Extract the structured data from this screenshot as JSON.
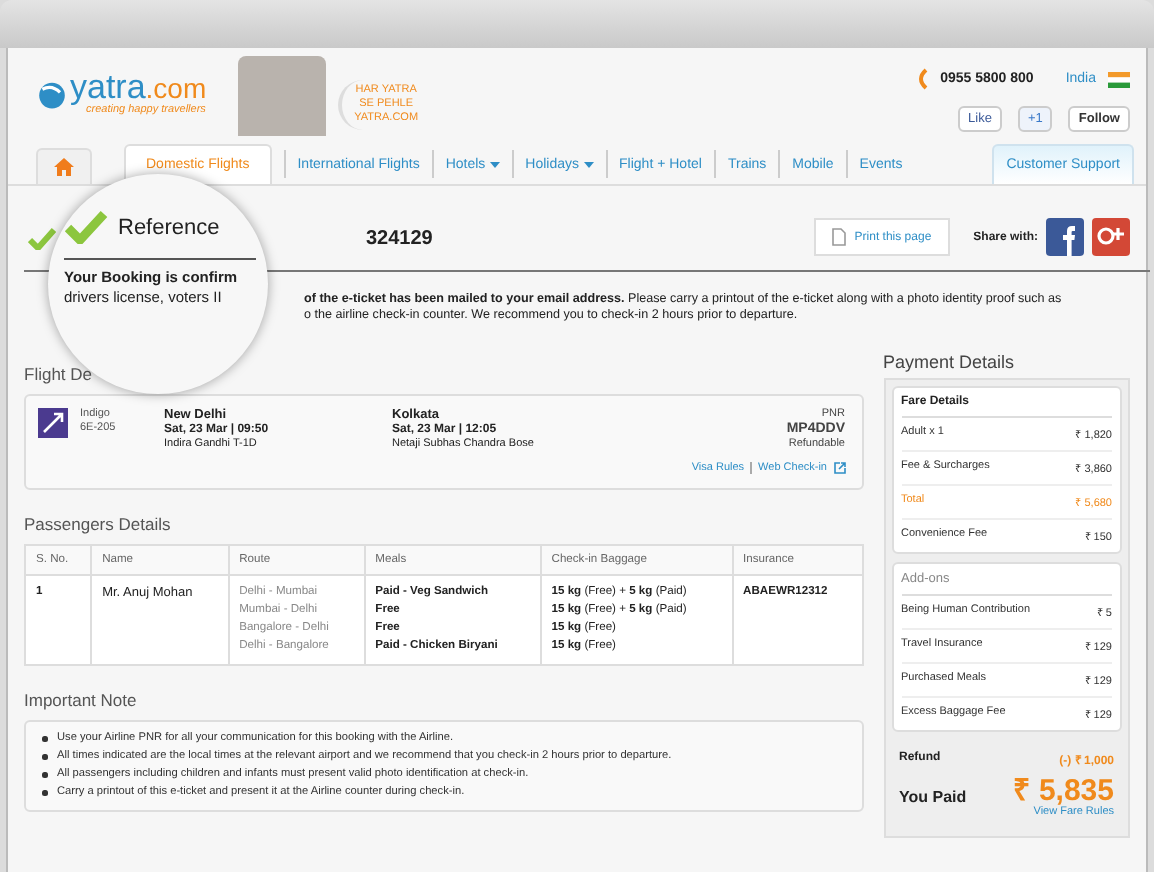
{
  "header": {
    "logo": "yatra",
    "logo_suffix": ".com",
    "tagline": "creating happy travellers",
    "slogan": [
      "HAR YATRA",
      "SE PEHLE",
      "YATRA.COM"
    ],
    "phone": "0955 5800 800",
    "country": "India",
    "social": [
      {
        "kind": "facebook",
        "label": "Like"
      },
      {
        "kind": "google",
        "label": "+1"
      },
      {
        "kind": "twitter",
        "label": "Follow"
      }
    ]
  },
  "nav": [
    {
      "kind": "home",
      "selected": false
    },
    {
      "kind": "tab",
      "label": "Domestic Flights",
      "selected": true
    },
    {
      "kind": "link",
      "label": "International Flights",
      "selected": false,
      "dropdown": false
    },
    {
      "kind": "link",
      "label": "Hotels",
      "selected": false,
      "dropdown": true
    },
    {
      "kind": "link",
      "label": "Holidays",
      "selected": false,
      "dropdown": true
    },
    {
      "kind": "link",
      "label": "Flight + Hotel",
      "selected": false,
      "dropdown": false
    },
    {
      "kind": "link",
      "label": "Trains",
      "selected": false,
      "dropdown": false
    },
    {
      "kind": "link",
      "label": "Mobile",
      "selected": false,
      "dropdown": false
    },
    {
      "kind": "link",
      "label": "Events",
      "selected": false,
      "dropdown": false
    }
  ],
  "support": "Customer Support",
  "reference": {
    "number": "324129",
    "print": "Print this page",
    "share": "Share with:"
  },
  "message": [
    "**of the e-ticket has been mailed to your email address.** Please carry a printout of the e-ticket along with a photo identity proof such as",
    "o the airline check-in counter. We recommend you to check-in 2 hours prior to departure."
  ],
  "magnifier": {
    "title": "Reference",
    "lines": [
      {
        "text": "Your Booking is confirm",
        "bold": true
      },
      {
        "text": "drivers license, voters II",
        "bold": false
      }
    ]
  },
  "flight": {
    "heading": "Flight De",
    "airline": "Indigo",
    "code": "6E-205",
    "from": {
      "city": "New Delhi",
      "time": "Sat, 23 Mar | 09:50",
      "terminal": "Indira Gandhi T-1D"
    },
    "to": {
      "city": "Kolkata",
      "time": "Sat, 23 Mar | 12:05",
      "terminal": "Netaji Subhas Chandra Bose"
    },
    "pnr_label": "PNR",
    "pnr": "MP4DDV",
    "fare_type": "Refundable",
    "links": [
      "Visa Rules",
      "Web Check-in"
    ]
  },
  "passengers": {
    "heading": "Passengers Details",
    "columns": [
      "S. No.",
      "Name",
      "Route",
      "Meals",
      "Check-in Baggage",
      "Insurance"
    ],
    "rows": [
      {
        "sno": "1",
        "name": "Mr. Anuj Mohan",
        "routes": [
          "Delhi - Mumbai",
          "Mumbai - Delhi",
          "Bangalore - Delhi",
          "Delhi - Bangalore"
        ],
        "meals": [
          "Paid - Veg Sandwich",
          "Free",
          "Free",
          "Paid - Chicken Biryani"
        ],
        "baggage": [
          "**15 kg** (Free) + **5 kg** (Paid)",
          "**15 kg** (Free) + **5 kg** (Paid)",
          "**15 kg** (Free)",
          "**15 kg** (Free)"
        ],
        "insurance": "ABAEWR12312"
      }
    ]
  },
  "note": {
    "heading": "Important Note",
    "items": [
      "Use your Airline PNR for all your communication for this booking with the Airline.",
      "All times indicated are the local times at the relevant airport and we recommend that you check-in 2 hours prior to departure.",
      "All passengers including children and infants must present valid photo identification at check-in.",
      "Carry a printout of this e-ticket and present it at the Airline counter during check-in."
    ]
  },
  "payment": {
    "heading": "Payment Details",
    "fare": {
      "title": "Fare Details",
      "rows": [
        {
          "label": "Adult x 1",
          "value": "₹ 1,820",
          "kind": "normal"
        },
        {
          "label": "Fee & Surcharges",
          "value": "₹ 3,860",
          "kind": "normal"
        },
        {
          "label": "Total",
          "value": "₹ 5,680",
          "kind": "total"
        },
        {
          "label": "Convenience Fee",
          "value": "₹ 150",
          "kind": "normal"
        }
      ]
    },
    "addons": {
      "title": "Add-ons",
      "rows": [
        {
          "label": "Being Human Contribution",
          "value": "₹ 5"
        },
        {
          "label": "Travel Insurance",
          "value": "₹ 129"
        },
        {
          "label": "Purchased Meals",
          "value": "₹ 129"
        },
        {
          "label": "Excess Baggage Fee",
          "value": "₹ 129"
        }
      ]
    },
    "refund": {
      "label": "Refund",
      "value": "(-) ₹ 1,000"
    },
    "paid": {
      "label": "You Paid",
      "value": "₹ 5,835",
      "link": "View Fare Rules"
    }
  }
}
